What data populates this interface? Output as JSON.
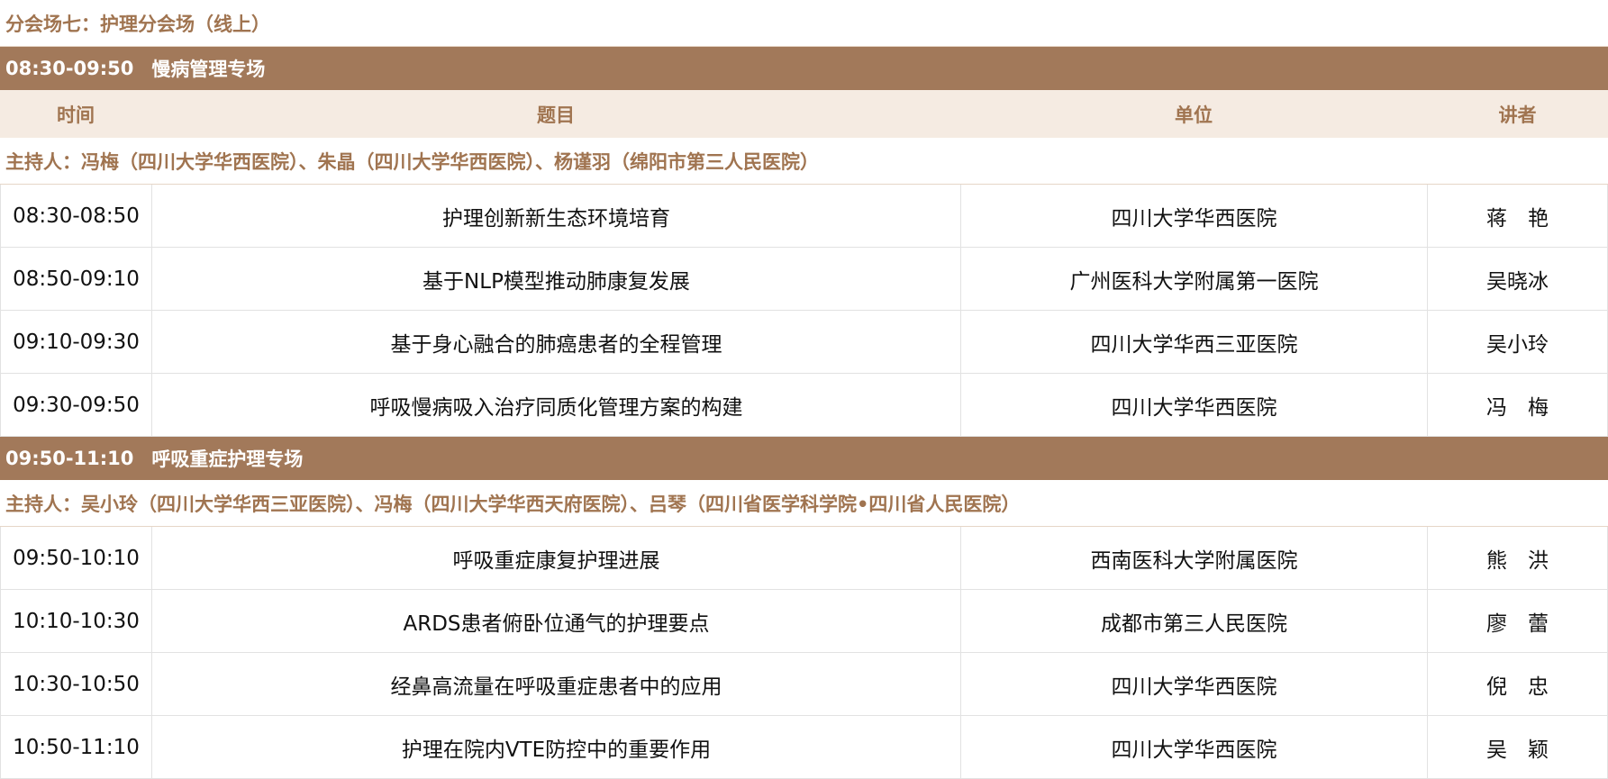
{
  "title": "分会场七：护理分会场（线上）",
  "columns": {
    "time": "时间",
    "topic": "题目",
    "unit": "单位",
    "speaker": "讲者"
  },
  "sessions": [
    {
      "time": "08:30-09:50",
      "name": "慢病管理专场",
      "hosts": "主持人：冯梅（四川大学华西医院）、朱晶（四川大学华西医院）、杨谨羽（绵阳市第三人民医院）",
      "talks": [
        {
          "time": "08:30-08:50",
          "topic": "护理创新新生态环境培育",
          "unit": "四川大学华西医院",
          "speaker": "蒋　艳"
        },
        {
          "time": "08:50-09:10",
          "topic": "基于NLP模型推动肺康复发展",
          "unit": "广州医科大学附属第一医院",
          "speaker": "吴晓冰"
        },
        {
          "time": "09:10-09:30",
          "topic": "基于身心融合的肺癌患者的全程管理",
          "unit": "四川大学华西三亚医院",
          "speaker": "吴小玲"
        },
        {
          "time": "09:30-09:50",
          "topic": "呼吸慢病吸入治疗同质化管理方案的构建",
          "unit": "四川大学华西医院",
          "speaker": "冯　梅"
        }
      ]
    },
    {
      "time": "09:50-11:10",
      "name": "呼吸重症护理专场",
      "hosts": "主持人：吴小玲（四川大学华西三亚医院）、冯梅（四川大学华西天府医院）、吕琴（四川省医学科学院•四川省人民医院）",
      "talks": [
        {
          "time": "09:50-10:10",
          "topic": "呼吸重症康复护理进展",
          "unit": "西南医科大学附属医院",
          "speaker": "熊　洪"
        },
        {
          "time": "10:10-10:30",
          "topic": "ARDS患者俯卧位通气的护理要点",
          "unit": "成都市第三人民医院",
          "speaker": "廖　蕾"
        },
        {
          "time": "10:30-10:50",
          "topic": "经鼻高流量在呼吸重症患者中的应用",
          "unit": "四川大学华西医院",
          "speaker": "倪　忠"
        },
        {
          "time": "10:50-11:10",
          "topic": "护理在院内VTE防控中的重要作用",
          "unit": "四川大学华西医院",
          "speaker": "吴　颖"
        }
      ]
    }
  ]
}
